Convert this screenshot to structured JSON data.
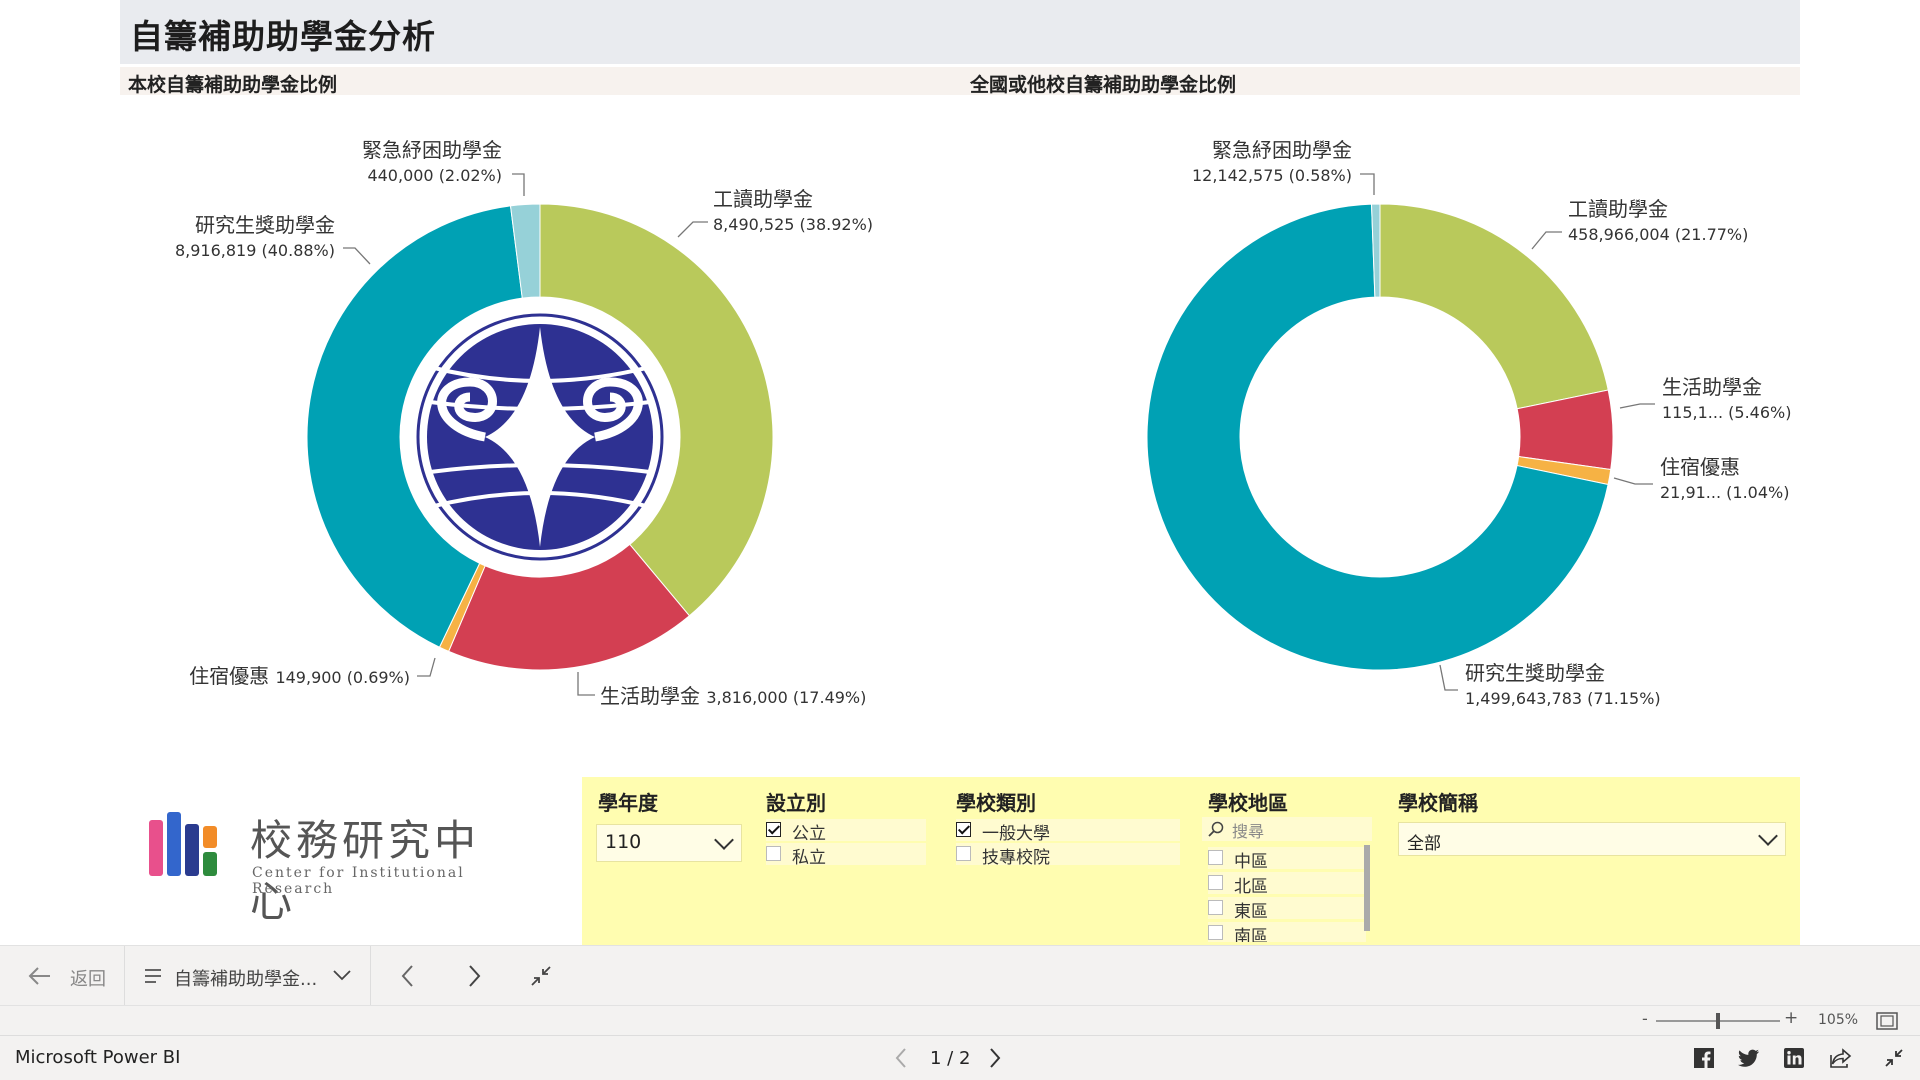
{
  "report": {
    "title": "自籌補助助學金分析",
    "left_section_title": "本校自籌補助助學金比例",
    "right_section_title": "全國或他校自籌補助助學金比例"
  },
  "chart_data": [
    {
      "type": "pie",
      "variant": "donut",
      "title": "本校自籌補助助學金比例",
      "slices": [
        {
          "label": "工讀助學金",
          "value": 8490525,
          "display": "8,490,525 (38.92%)",
          "percent": 38.92,
          "color": "#b9c95b"
        },
        {
          "label": "生活助學金",
          "value": 3816000,
          "display": "3,816,000 (17.49%)",
          "percent": 17.49,
          "color": "#d33f52"
        },
        {
          "label": "住宿優惠",
          "value": 149900,
          "display": "149,900 (0.69%)",
          "percent": 0.69,
          "color": "#f6b244"
        },
        {
          "label": "研究生獎助學金",
          "value": 8916819,
          "display": "8,916,819 (40.88%)",
          "percent": 40.88,
          "color": "#00a1b4"
        },
        {
          "label": "緊急紓困助學金",
          "value": 440000,
          "display": "440,000 (2.02%)",
          "percent": 2.02,
          "color": "#96d1d8"
        }
      ]
    },
    {
      "type": "pie",
      "variant": "donut",
      "title": "全國或他校自籌補助助學金比例",
      "slices": [
        {
          "label": "工讀助學金",
          "value": 458966004,
          "display": "458,966,004 (21.77%)",
          "percent": 21.77,
          "color": "#b9c95b"
        },
        {
          "label": "生活助學金",
          "value": null,
          "display": "115,1... (5.46%)",
          "percent": 5.46,
          "color": "#d33f52"
        },
        {
          "label": "住宿優惠",
          "value": null,
          "display": "21,91... (1.04%)",
          "percent": 1.04,
          "color": "#f6b244"
        },
        {
          "label": "研究生獎助學金",
          "value": 1499643783,
          "display": "1,499,643,783 (71.15%)",
          "percent": 71.15,
          "color": "#00a1b4"
        },
        {
          "label": "緊急紓困助學金",
          "value": 12142575,
          "display": "12,142,575 (0.58%)",
          "percent": 0.58,
          "color": "#96d1d8"
        }
      ]
    }
  ],
  "logo": {
    "name": "校務研究中心",
    "subtitle": "Center for Institutional Research"
  },
  "slicers": {
    "year": {
      "title": "學年度",
      "value": "110"
    },
    "establish": {
      "title": "設立別",
      "options": [
        {
          "label": "公立",
          "checked": true
        },
        {
          "label": "私立",
          "checked": false
        }
      ]
    },
    "school_type": {
      "title": "學校類別",
      "options": [
        {
          "label": "一般大學",
          "checked": true
        },
        {
          "label": "技專校院",
          "checked": false
        }
      ]
    },
    "region": {
      "title": "學校地區",
      "search_placeholder": "搜尋",
      "options": [
        {
          "label": "中區",
          "checked": false
        },
        {
          "label": "北區",
          "checked": false
        },
        {
          "label": "東區",
          "checked": false
        },
        {
          "label": "南區",
          "checked": false
        }
      ]
    },
    "school_name": {
      "title": "學校簡稱",
      "value": "全部"
    }
  },
  "nav": {
    "back_label": "返回",
    "page_label": "自籌補助助學金...",
    "page_indicator": "1 / 2",
    "zoom": "105%"
  },
  "app": {
    "name": "Microsoft Power BI"
  }
}
